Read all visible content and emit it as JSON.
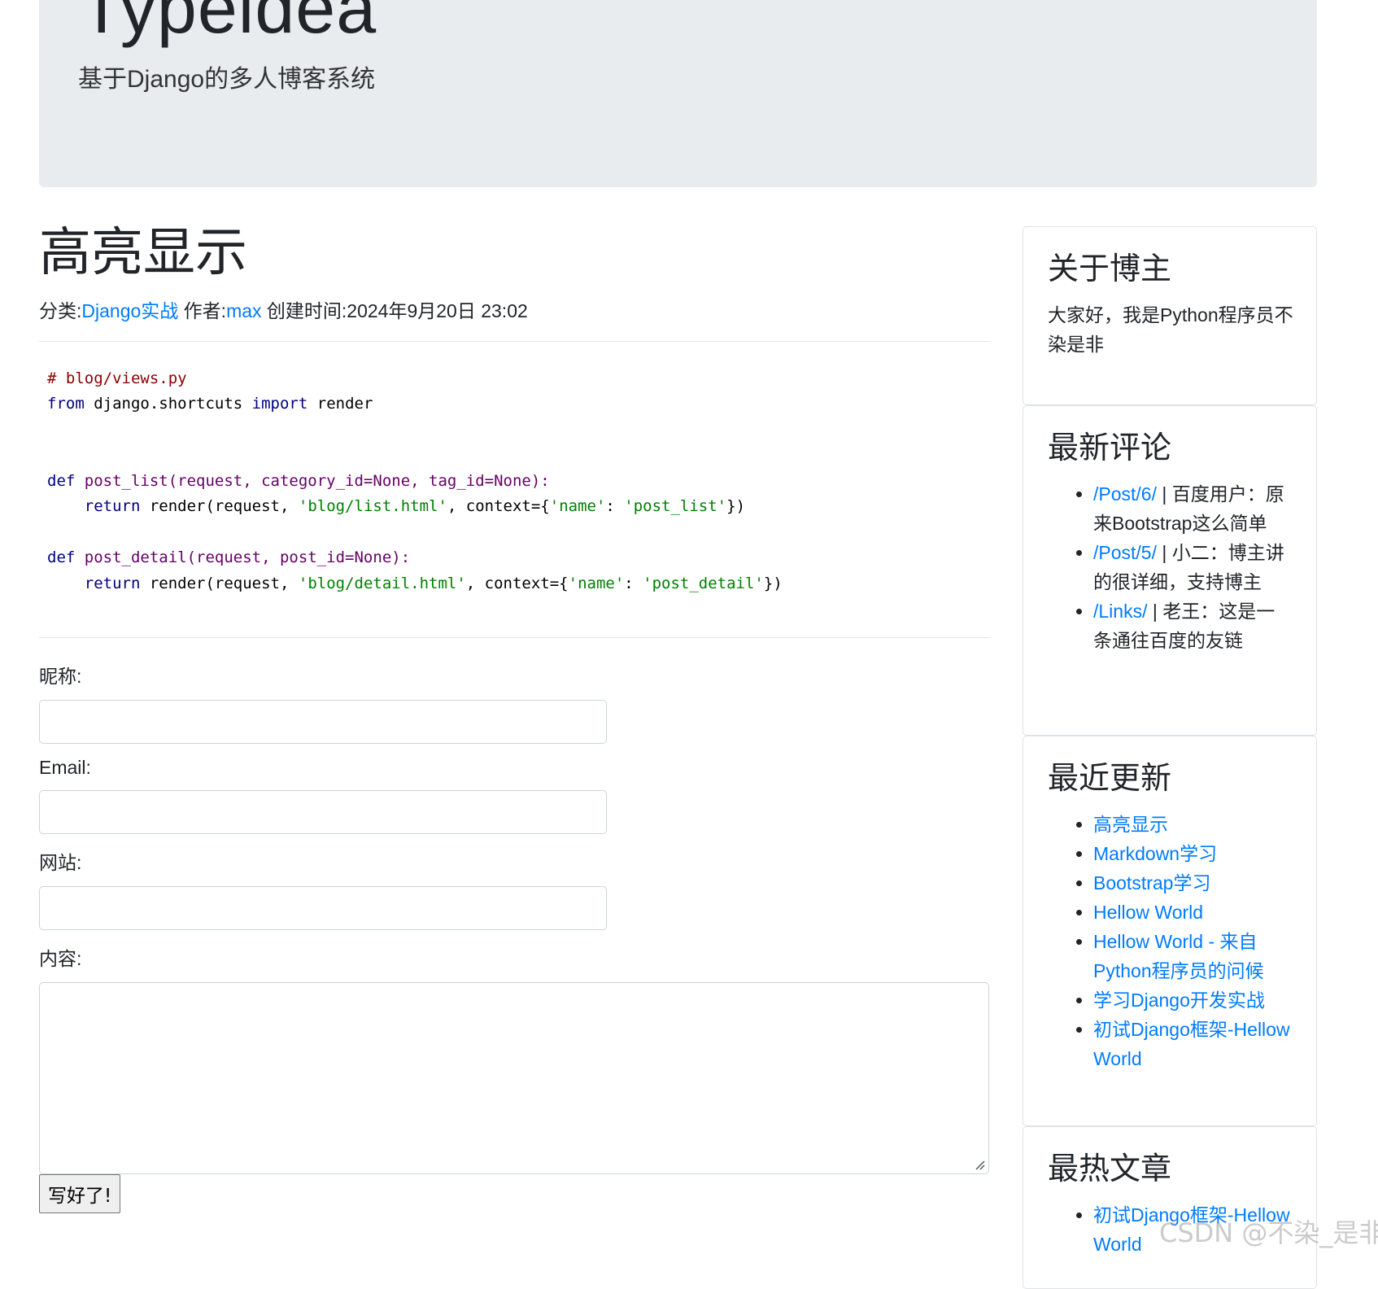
{
  "header": {
    "brand": "Typeidea",
    "subtitle": "基于Django的多人博客系统"
  },
  "post": {
    "title": "高亮显示",
    "category_label": "分类:",
    "category": "Django实战",
    "author_label": "作者:",
    "author": "max",
    "created_label": "创建时间:",
    "created": "2024年9月20日 23:02"
  },
  "code": {
    "comment": "# blog/views.py",
    "import_from": "from",
    "import_module": " django.shortcuts ",
    "import_kw": "import",
    "import_name": " render",
    "def1_kw": "def",
    "def1_sig": " post_list(request, category_id=None, tag_id=None):",
    "ret1_kw": "return",
    "ret1_pre": " render(request, ",
    "ret1_tpl": "'blog/list.html'",
    "ret1_mid": ", context={",
    "ret1_key": "'name'",
    "ret1_colon": ": ",
    "ret1_val": "'post_list'",
    "ret1_end": "})",
    "def2_kw": "def",
    "def2_sig": " post_detail(request, post_id=None):",
    "ret2_kw": "return",
    "ret2_pre": " render(request, ",
    "ret2_tpl": "'blog/detail.html'",
    "ret2_mid": ", context={",
    "ret2_key": "'name'",
    "ret2_colon": ": ",
    "ret2_val": "'post_detail'",
    "ret2_end": "})"
  },
  "comment_form": {
    "nickname_label": "昵称:",
    "nickname_value": "",
    "email_label": "Email:",
    "email_value": "",
    "website_label": "网站:",
    "website_value": "",
    "content_label": "内容:",
    "content_value": "",
    "submit_label": "写好了!"
  },
  "sidebar": {
    "about": {
      "title": "关于博主",
      "text": "大家好，我是Python程序员不染是非"
    },
    "latest_comments": {
      "title": "最新评论",
      "items": [
        {
          "link": "/Post/6/",
          "text": " | 百度用户：原来Bootstrap这么简单"
        },
        {
          "link": "/Post/5/",
          "text": " | 小二：博主讲的很详细，支持博主"
        },
        {
          "link": "/Links/",
          "text": " | 老王：这是一条通往百度的友链"
        }
      ]
    },
    "recent_updates": {
      "title": "最近更新",
      "items": [
        "高亮显示",
        "Markdown学习",
        "Bootstrap学习",
        "Hellow World",
        "Hellow World - 来自Python程序员的问候",
        "学习Django开发实战",
        "初试Django框架-Hellow World"
      ]
    },
    "hot_posts": {
      "title": "最热文章",
      "items": [
        "初试Django框架-Hellow World"
      ]
    }
  },
  "watermark": "CSDN @不染_是非"
}
